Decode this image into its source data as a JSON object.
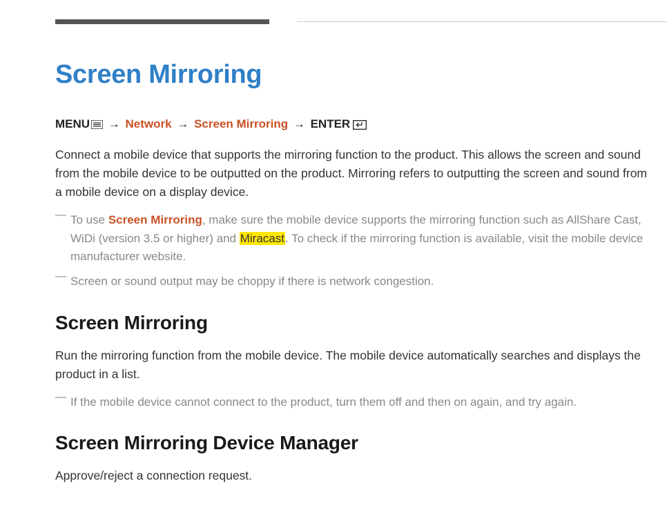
{
  "title": "Screen Mirroring",
  "breadcrumb": {
    "menu": "MENU",
    "network": "Network",
    "screen_mirroring": "Screen Mirroring",
    "enter": "ENTER"
  },
  "intro_paragraph": "Connect a mobile device that supports the mirroring function to the product. This allows the screen and sound from the mobile device to be outputted on the product. Mirroring refers to outputting the screen and sound from a mobile device on a display device.",
  "notes_main": {
    "note1_prefix": "To use ",
    "note1_link": "Screen Mirroring",
    "note1_mid": ", make sure the mobile device supports the mirroring function such as AllShare Cast, WiDi (version 3.5 or higher) and ",
    "note1_highlight": "Miracast",
    "note1_suffix": ". To check if the mirroring function is available, visit the mobile device manufacturer website.",
    "note2": "Screen or sound output may be choppy if there is network congestion."
  },
  "section2": {
    "heading": "Screen Mirroring",
    "paragraph": "Run the mirroring function from the mobile device. The mobile device automatically searches and displays the product in a list.",
    "note": "If the mobile device cannot connect to the product, turn them off and then on again, and try again."
  },
  "section3": {
    "heading": "Screen Mirroring Device Manager",
    "paragraph": "Approve/reject a connection request."
  }
}
